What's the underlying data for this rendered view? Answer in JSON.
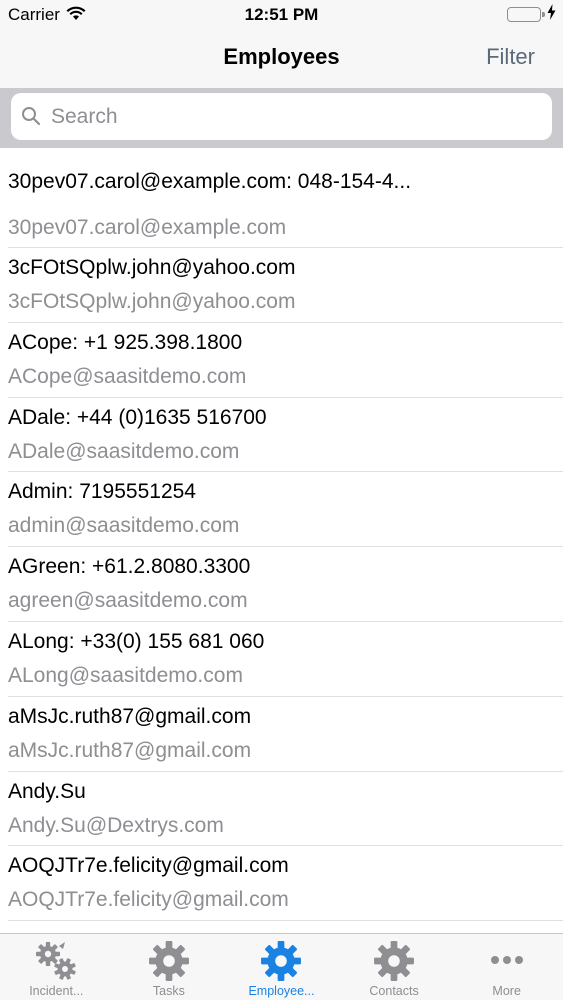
{
  "status_bar": {
    "carrier": "Carrier",
    "time": "12:51 PM"
  },
  "nav": {
    "title": "Employees",
    "filter_label": "Filter"
  },
  "search": {
    "placeholder": "Search",
    "value": ""
  },
  "employees": [
    {
      "title": "30pev07.carol@example.com: 048-154-4...",
      "subtitle": "30pev07.carol@example.com"
    },
    {
      "title": "3cFOtSQplw.john@yahoo.com",
      "subtitle": "3cFOtSQplw.john@yahoo.com"
    },
    {
      "title": "ACope: +1 925.398.1800",
      "subtitle": "ACope@saasitdemo.com"
    },
    {
      "title": "ADale: +44 (0)1635 516700",
      "subtitle": "ADale@saasitdemo.com"
    },
    {
      "title": "Admin: 7195551254",
      "subtitle": "admin@saasitdemo.com"
    },
    {
      "title": "AGreen: +61.2.8080.3300",
      "subtitle": "agreen@saasitdemo.com"
    },
    {
      "title": "ALong: +33(0) 155 681 060",
      "subtitle": "ALong@saasitdemo.com"
    },
    {
      "title": "aMsJc.ruth87@gmail.com",
      "subtitle": "aMsJc.ruth87@gmail.com"
    },
    {
      "title": "Andy.Su",
      "subtitle": "Andy.Su@Dextrys.com"
    },
    {
      "title": "AOQJTr7e.felicity@gmail.com",
      "subtitle": "AOQJTr7e.felicity@gmail.com"
    }
  ],
  "tabs": [
    {
      "label": "Incident...",
      "icon": "gears-icon",
      "active": false
    },
    {
      "label": "Tasks",
      "icon": "gear-icon",
      "active": false
    },
    {
      "label": "Employee...",
      "icon": "gear-icon",
      "active": true
    },
    {
      "label": "Contacts",
      "icon": "gear-icon",
      "active": false
    },
    {
      "label": "More",
      "icon": "more-dots-icon",
      "active": false
    }
  ],
  "colors": {
    "accent": "#1a82e2",
    "inactive": "#8e8e93",
    "battery": "#4cd964"
  }
}
